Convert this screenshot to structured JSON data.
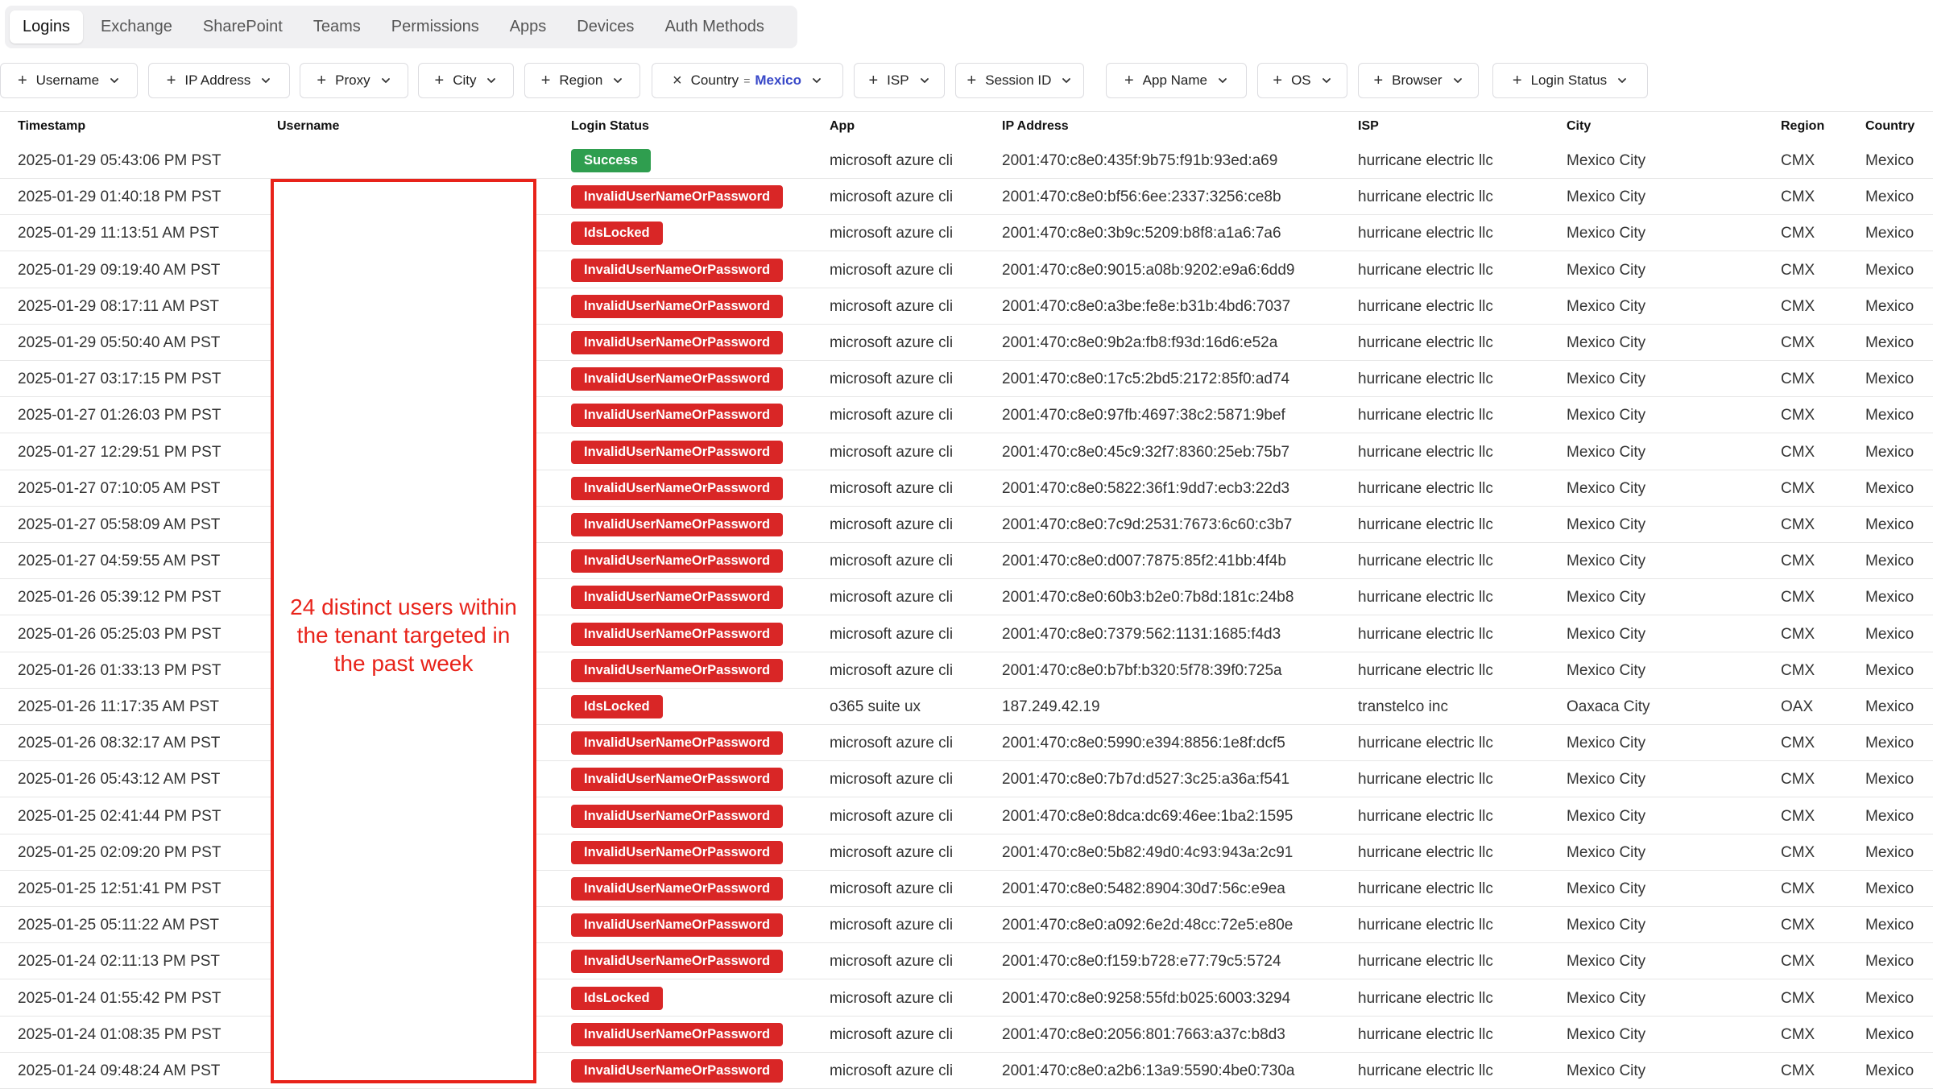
{
  "tabs": [
    "Logins",
    "Exchange",
    "SharePoint",
    "Teams",
    "Permissions",
    "Apps",
    "Devices",
    "Auth Methods"
  ],
  "active_tab": "Logins",
  "filters": [
    {
      "label": "Username"
    },
    {
      "label": "IP Address"
    },
    {
      "label": "Proxy"
    },
    {
      "label": "City"
    },
    {
      "label": "Region"
    },
    {
      "label": "Country",
      "operator": "=",
      "value": "Mexico",
      "applied": true
    },
    {
      "label": "ISP"
    },
    {
      "label": "Session ID"
    },
    {
      "label": "App Name"
    },
    {
      "label": "OS"
    },
    {
      "label": "Browser"
    },
    {
      "label": "Login Status"
    }
  ],
  "columns": [
    "Timestamp",
    "Username",
    "Login Status",
    "App",
    "IP Address",
    "ISP",
    "City",
    "Region",
    "Country"
  ],
  "colors": {
    "status_red": "#d92626",
    "status_green": "#2f9e4f",
    "annotation": "#e8231a",
    "filter_value": "#3848c8"
  },
  "rows": [
    {
      "timestamp": "2025-01-29 05:43:06 PM PST",
      "status": "Success",
      "app": "microsoft azure cli",
      "ip": "2001:470:c8e0:435f:9b75:f91b:93ed:a69",
      "isp": "hurricane electric llc",
      "city": "Mexico City",
      "region": "CMX",
      "country": "Mexico"
    },
    {
      "timestamp": "2025-01-29 01:40:18 PM PST",
      "status": "InvalidUserNameOrPassword",
      "app": "microsoft azure cli",
      "ip": "2001:470:c8e0:bf56:6ee:2337:3256:ce8b",
      "isp": "hurricane electric llc",
      "city": "Mexico City",
      "region": "CMX",
      "country": "Mexico"
    },
    {
      "timestamp": "2025-01-29 11:13:51 AM PST",
      "status": "IdsLocked",
      "app": "microsoft azure cli",
      "ip": "2001:470:c8e0:3b9c:5209:b8f8:a1a6:7a6",
      "isp": "hurricane electric llc",
      "city": "Mexico City",
      "region": "CMX",
      "country": "Mexico"
    },
    {
      "timestamp": "2025-01-29 09:19:40 AM PST",
      "status": "InvalidUserNameOrPassword",
      "app": "microsoft azure cli",
      "ip": "2001:470:c8e0:9015:a08b:9202:e9a6:6dd9",
      "isp": "hurricane electric llc",
      "city": "Mexico City",
      "region": "CMX",
      "country": "Mexico"
    },
    {
      "timestamp": "2025-01-29 08:17:11 AM PST",
      "status": "InvalidUserNameOrPassword",
      "app": "microsoft azure cli",
      "ip": "2001:470:c8e0:a3be:fe8e:b31b:4bd6:7037",
      "isp": "hurricane electric llc",
      "city": "Mexico City",
      "region": "CMX",
      "country": "Mexico"
    },
    {
      "timestamp": "2025-01-29 05:50:40 AM PST",
      "status": "InvalidUserNameOrPassword",
      "app": "microsoft azure cli",
      "ip": "2001:470:c8e0:9b2a:fb8:f93d:16d6:e52a",
      "isp": "hurricane electric llc",
      "city": "Mexico City",
      "region": "CMX",
      "country": "Mexico"
    },
    {
      "timestamp": "2025-01-27 03:17:15 PM PST",
      "status": "InvalidUserNameOrPassword",
      "app": "microsoft azure cli",
      "ip": "2001:470:c8e0:17c5:2bd5:2172:85f0:ad74",
      "isp": "hurricane electric llc",
      "city": "Mexico City",
      "region": "CMX",
      "country": "Mexico"
    },
    {
      "timestamp": "2025-01-27 01:26:03 PM PST",
      "status": "InvalidUserNameOrPassword",
      "app": "microsoft azure cli",
      "ip": "2001:470:c8e0:97fb:4697:38c2:5871:9bef",
      "isp": "hurricane electric llc",
      "city": "Mexico City",
      "region": "CMX",
      "country": "Mexico"
    },
    {
      "timestamp": "2025-01-27 12:29:51 PM PST",
      "status": "InvalidUserNameOrPassword",
      "app": "microsoft azure cli",
      "ip": "2001:470:c8e0:45c9:32f7:8360:25eb:75b7",
      "isp": "hurricane electric llc",
      "city": "Mexico City",
      "region": "CMX",
      "country": "Mexico"
    },
    {
      "timestamp": "2025-01-27 07:10:05 AM PST",
      "status": "InvalidUserNameOrPassword",
      "app": "microsoft azure cli",
      "ip": "2001:470:c8e0:5822:36f1:9dd7:ecb3:22d3",
      "isp": "hurricane electric llc",
      "city": "Mexico City",
      "region": "CMX",
      "country": "Mexico"
    },
    {
      "timestamp": "2025-01-27 05:58:09 AM PST",
      "status": "InvalidUserNameOrPassword",
      "app": "microsoft azure cli",
      "ip": "2001:470:c8e0:7c9d:2531:7673:6c60:c3b7",
      "isp": "hurricane electric llc",
      "city": "Mexico City",
      "region": "CMX",
      "country": "Mexico"
    },
    {
      "timestamp": "2025-01-27 04:59:55 AM PST",
      "status": "InvalidUserNameOrPassword",
      "app": "microsoft azure cli",
      "ip": "2001:470:c8e0:d007:7875:85f2:41bb:4f4b",
      "isp": "hurricane electric llc",
      "city": "Mexico City",
      "region": "CMX",
      "country": "Mexico"
    },
    {
      "timestamp": "2025-01-26 05:39:12 PM PST",
      "status": "InvalidUserNameOrPassword",
      "app": "microsoft azure cli",
      "ip": "2001:470:c8e0:60b3:b2e0:7b8d:181c:24b8",
      "isp": "hurricane electric llc",
      "city": "Mexico City",
      "region": "CMX",
      "country": "Mexico"
    },
    {
      "timestamp": "2025-01-26 05:25:03 PM PST",
      "status": "InvalidUserNameOrPassword",
      "app": "microsoft azure cli",
      "ip": "2001:470:c8e0:7379:562:1131:1685:f4d3",
      "isp": "hurricane electric llc",
      "city": "Mexico City",
      "region": "CMX",
      "country": "Mexico"
    },
    {
      "timestamp": "2025-01-26 01:33:13 PM PST",
      "status": "InvalidUserNameOrPassword",
      "app": "microsoft azure cli",
      "ip": "2001:470:c8e0:b7bf:b320:5f78:39f0:725a",
      "isp": "hurricane electric llc",
      "city": "Mexico City",
      "region": "CMX",
      "country": "Mexico"
    },
    {
      "timestamp": "2025-01-26 11:17:35 AM PST",
      "status": "IdsLocked",
      "app": "o365 suite ux",
      "ip": "187.249.42.19",
      "isp": "transtelco inc",
      "city": "Oaxaca City",
      "region": "OAX",
      "country": "Mexico"
    },
    {
      "timestamp": "2025-01-26 08:32:17 AM PST",
      "status": "InvalidUserNameOrPassword",
      "app": "microsoft azure cli",
      "ip": "2001:470:c8e0:5990:e394:8856:1e8f:dcf5",
      "isp": "hurricane electric llc",
      "city": "Mexico City",
      "region": "CMX",
      "country": "Mexico"
    },
    {
      "timestamp": "2025-01-26 05:43:12 AM PST",
      "status": "InvalidUserNameOrPassword",
      "app": "microsoft azure cli",
      "ip": "2001:470:c8e0:7b7d:d527:3c25:a36a:f541",
      "isp": "hurricane electric llc",
      "city": "Mexico City",
      "region": "CMX",
      "country": "Mexico"
    },
    {
      "timestamp": "2025-01-25 02:41:44 PM PST",
      "status": "InvalidUserNameOrPassword",
      "app": "microsoft azure cli",
      "ip": "2001:470:c8e0:8dca:dc69:46ee:1ba2:1595",
      "isp": "hurricane electric llc",
      "city": "Mexico City",
      "region": "CMX",
      "country": "Mexico"
    },
    {
      "timestamp": "2025-01-25 02:09:20 PM PST",
      "status": "InvalidUserNameOrPassword",
      "app": "microsoft azure cli",
      "ip": "2001:470:c8e0:5b82:49d0:4c93:943a:2c91",
      "isp": "hurricane electric llc",
      "city": "Mexico City",
      "region": "CMX",
      "country": "Mexico"
    },
    {
      "timestamp": "2025-01-25 12:51:41 PM PST",
      "status": "InvalidUserNameOrPassword",
      "app": "microsoft azure cli",
      "ip": "2001:470:c8e0:5482:8904:30d7:56c:e9ea",
      "isp": "hurricane electric llc",
      "city": "Mexico City",
      "region": "CMX",
      "country": "Mexico"
    },
    {
      "timestamp": "2025-01-25 05:11:22 AM PST",
      "status": "InvalidUserNameOrPassword",
      "app": "microsoft azure cli",
      "ip": "2001:470:c8e0:a092:6e2d:48cc:72e5:e80e",
      "isp": "hurricane electric llc",
      "city": "Mexico City",
      "region": "CMX",
      "country": "Mexico"
    },
    {
      "timestamp": "2025-01-24 02:11:13 PM PST",
      "status": "InvalidUserNameOrPassword",
      "app": "microsoft azure cli",
      "ip": "2001:470:c8e0:f159:b728:e77:79c5:5724",
      "isp": "hurricane electric llc",
      "city": "Mexico City",
      "region": "CMX",
      "country": "Mexico"
    },
    {
      "timestamp": "2025-01-24 01:55:42 PM PST",
      "status": "IdsLocked",
      "app": "microsoft azure cli",
      "ip": "2001:470:c8e0:9258:55fd:b025:6003:3294",
      "isp": "hurricane electric llc",
      "city": "Mexico City",
      "region": "CMX",
      "country": "Mexico"
    },
    {
      "timestamp": "2025-01-24 01:08:35 PM PST",
      "status": "InvalidUserNameOrPassword",
      "app": "microsoft azure cli",
      "ip": "2001:470:c8e0:2056:801:7663:a37c:b8d3",
      "isp": "hurricane electric llc",
      "city": "Mexico City",
      "region": "CMX",
      "country": "Mexico"
    },
    {
      "timestamp": "2025-01-24 09:48:24 AM PST",
      "status": "InvalidUserNameOrPassword",
      "app": "microsoft azure cli",
      "ip": "2001:470:c8e0:a2b6:13a9:5590:4be0:730a",
      "isp": "hurricane electric llc",
      "city": "Mexico City",
      "region": "CMX",
      "country": "Mexico"
    }
  ],
  "annotation": {
    "text": "24 distinct users within the tenant targeted in the past week"
  }
}
